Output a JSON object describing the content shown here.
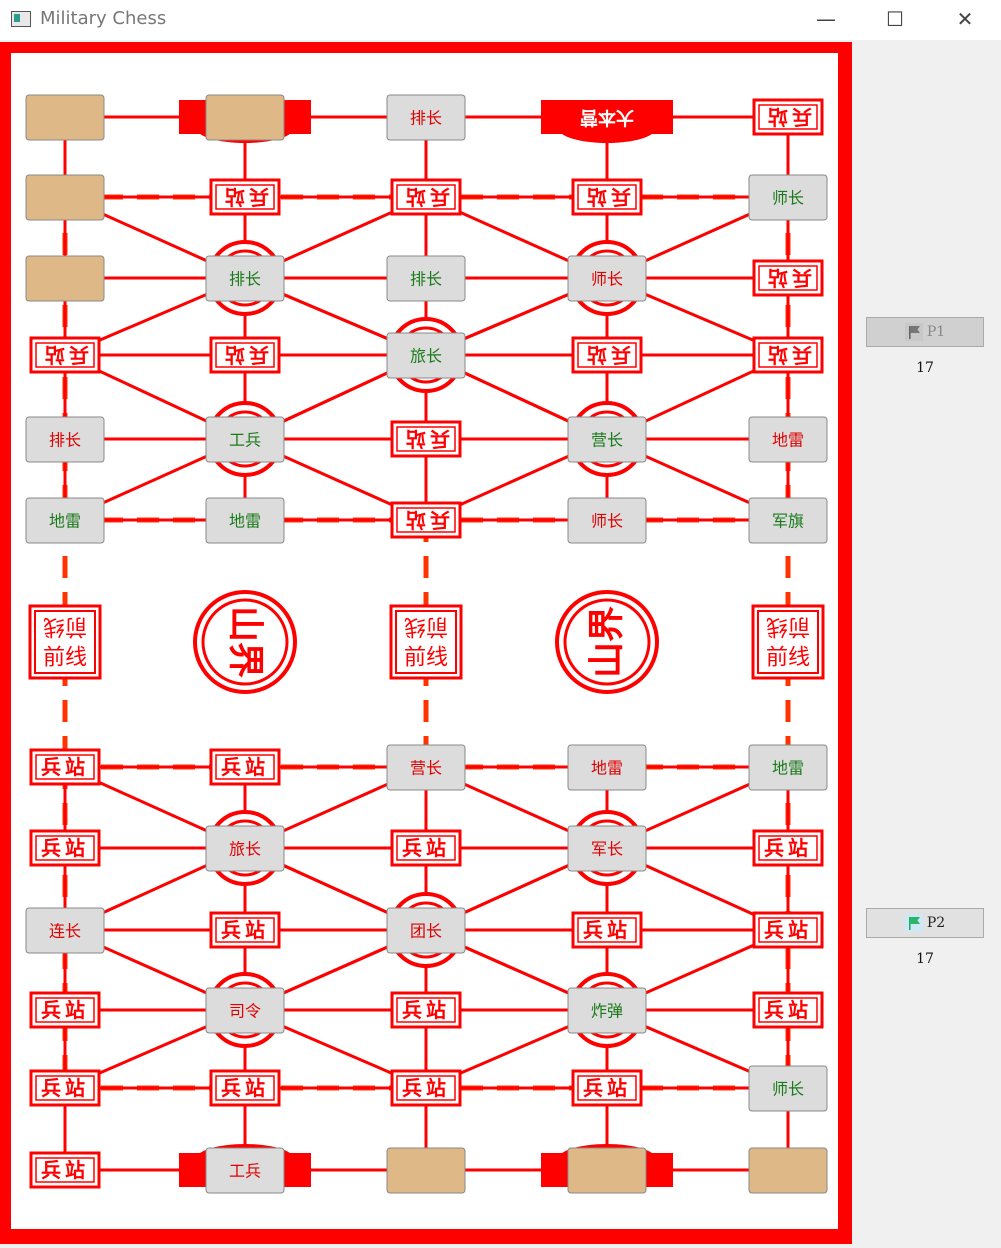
{
  "window": {
    "title": "Military Chess",
    "minimize": "—",
    "maximize": "☐",
    "close": "✕"
  },
  "colors": {
    "board_red": "#ff0000",
    "rail": "#ff3300",
    "piece_bg": "#dcdcdc",
    "hidden_piece": "#deb887",
    "green_text": "#1a7a1a",
    "red_text": "#e00000"
  },
  "board": {
    "columns": 5,
    "rows": 13,
    "station_label": "兵站",
    "frontline_label": "前线",
    "mountain_label": "山界",
    "headquarters_label": "大本营",
    "grid_labels": [
      [
        "",
        "",
        "",
        "大本营",
        "兵站"
      ],
      [
        "",
        "兵站",
        "兵站",
        "兵站",
        ""
      ],
      [
        "",
        "",
        "",
        "",
        "兵站"
      ],
      [
        "兵站",
        "兵站",
        "",
        "兵站",
        "兵站"
      ],
      [
        "",
        "",
        "兵站",
        "",
        ""
      ],
      [
        "",
        "",
        "兵站",
        "",
        ""
      ],
      [
        "前线",
        "山界",
        "前线",
        "山界",
        "前线"
      ],
      [
        "兵站",
        "兵站",
        "",
        "",
        ""
      ],
      [
        "兵站",
        "",
        "兵站",
        "",
        "兵站"
      ],
      [
        "",
        "兵站",
        "",
        "兵站",
        "兵站"
      ],
      [
        "兵站",
        "",
        "兵站",
        "",
        "兵站"
      ],
      [
        "兵站",
        "兵站",
        "兵站",
        "兵站",
        ""
      ],
      [
        "兵站",
        "",
        "",
        "",
        ""
      ]
    ],
    "pieces": [
      {
        "row": 0,
        "col": 0,
        "label": "",
        "hidden": true,
        "side": "none"
      },
      {
        "row": 0,
        "col": 1,
        "label": "",
        "hidden": true,
        "side": "none"
      },
      {
        "row": 0,
        "col": 2,
        "label": "排长",
        "hidden": false,
        "side": "red"
      },
      {
        "row": 1,
        "col": 0,
        "label": "",
        "hidden": true,
        "side": "none"
      },
      {
        "row": 1,
        "col": 4,
        "label": "师长",
        "hidden": false,
        "side": "green"
      },
      {
        "row": 2,
        "col": 0,
        "label": "",
        "hidden": true,
        "side": "none"
      },
      {
        "row": 2,
        "col": 1,
        "label": "排长",
        "hidden": false,
        "side": "green"
      },
      {
        "row": 2,
        "col": 2,
        "label": "排长",
        "hidden": false,
        "side": "green"
      },
      {
        "row": 2,
        "col": 3,
        "label": "师长",
        "hidden": false,
        "side": "red"
      },
      {
        "row": 3,
        "col": 2,
        "label": "旅长",
        "hidden": false,
        "side": "green"
      },
      {
        "row": 4,
        "col": 0,
        "label": "排长",
        "hidden": false,
        "side": "red"
      },
      {
        "row": 4,
        "col": 1,
        "label": "工兵",
        "hidden": false,
        "side": "green"
      },
      {
        "row": 4,
        "col": 3,
        "label": "营长",
        "hidden": false,
        "side": "green"
      },
      {
        "row": 4,
        "col": 4,
        "label": "地雷",
        "hidden": false,
        "side": "red"
      },
      {
        "row": 5,
        "col": 0,
        "label": "地雷",
        "hidden": false,
        "side": "green"
      },
      {
        "row": 5,
        "col": 1,
        "label": "地雷",
        "hidden": false,
        "side": "green"
      },
      {
        "row": 5,
        "col": 3,
        "label": "师长",
        "hidden": false,
        "side": "red"
      },
      {
        "row": 5,
        "col": 4,
        "label": "军旗",
        "hidden": false,
        "side": "green"
      },
      {
        "row": 7,
        "col": 2,
        "label": "营长",
        "hidden": false,
        "side": "red"
      },
      {
        "row": 7,
        "col": 3,
        "label": "地雷",
        "hidden": false,
        "side": "red"
      },
      {
        "row": 7,
        "col": 4,
        "label": "地雷",
        "hidden": false,
        "side": "green"
      },
      {
        "row": 8,
        "col": 1,
        "label": "旅长",
        "hidden": false,
        "side": "red"
      },
      {
        "row": 8,
        "col": 3,
        "label": "军长",
        "hidden": false,
        "side": "red"
      },
      {
        "row": 9,
        "col": 0,
        "label": "连长",
        "hidden": false,
        "side": "red"
      },
      {
        "row": 9,
        "col": 2,
        "label": "团长",
        "hidden": false,
        "side": "red"
      },
      {
        "row": 10,
        "col": 1,
        "label": "司令",
        "hidden": false,
        "side": "red"
      },
      {
        "row": 10,
        "col": 3,
        "label": "炸弹",
        "hidden": false,
        "side": "green"
      },
      {
        "row": 11,
        "col": 4,
        "label": "师长",
        "hidden": false,
        "side": "green"
      },
      {
        "row": 12,
        "col": 1,
        "label": "工兵",
        "hidden": false,
        "side": "red"
      },
      {
        "row": 12,
        "col": 2,
        "label": "",
        "hidden": true,
        "side": "none"
      },
      {
        "row": 12,
        "col": 3,
        "label": "",
        "hidden": true,
        "side": "none"
      },
      {
        "row": 12,
        "col": 4,
        "label": "",
        "hidden": true,
        "side": "none"
      }
    ]
  },
  "players": {
    "p1": {
      "label": "P1",
      "count": "17",
      "flag_icon": "flag-gray-icon",
      "disabled": true
    },
    "p2": {
      "label": "P2",
      "count": "17",
      "flag_icon": "flag-green-icon",
      "disabled": false
    }
  }
}
